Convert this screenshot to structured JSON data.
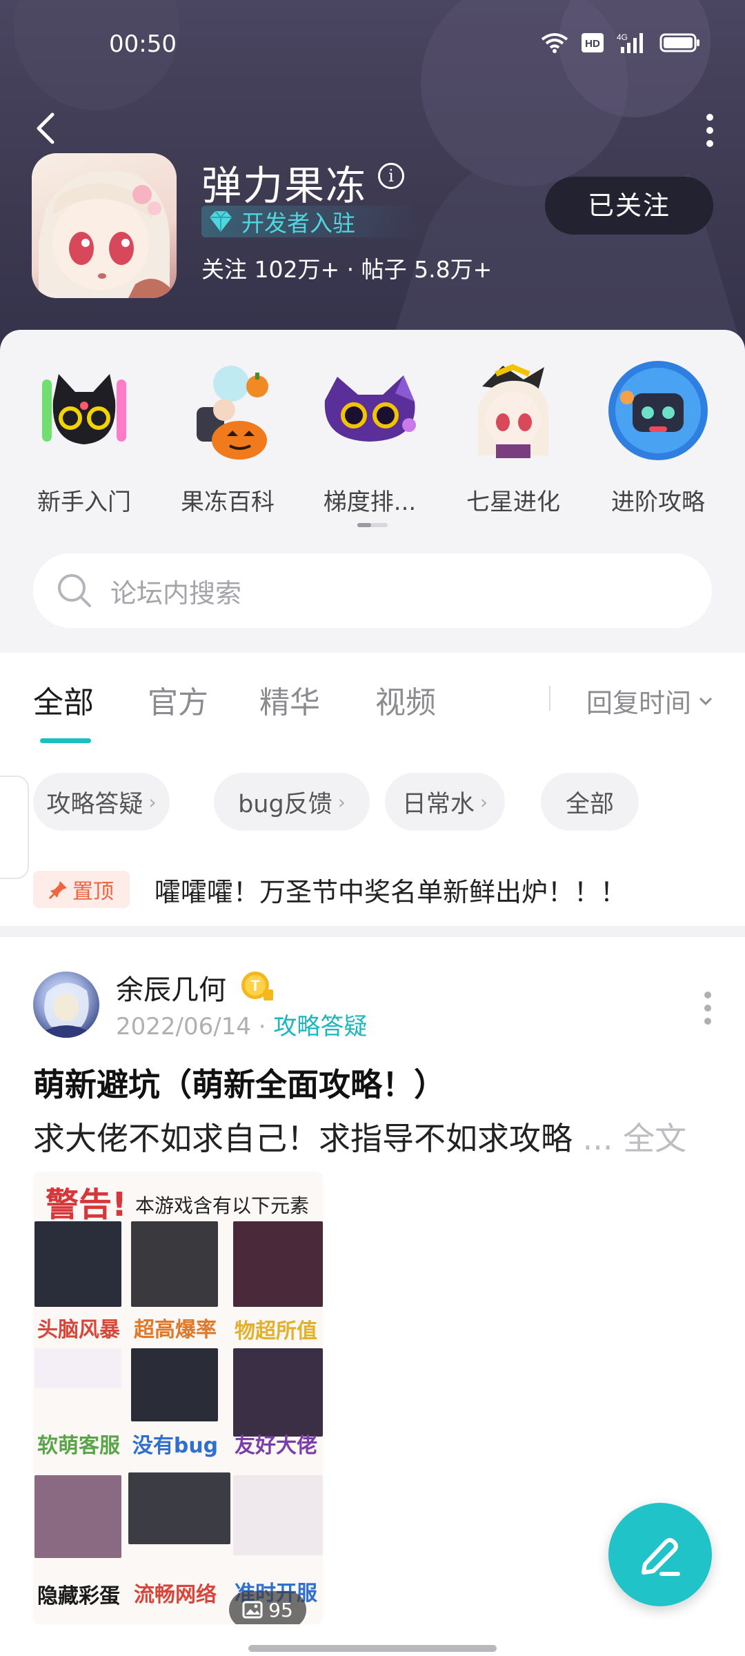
{
  "status_bar": {
    "time": "00:50",
    "icons": [
      "wifi-icon",
      "hd-icon",
      "signal-4g-icon",
      "battery-icon"
    ]
  },
  "header": {
    "app_name": "弹力果冻",
    "badge": "开发者入驻",
    "stats": "关注 102万+ · 帖子 5.8万+",
    "follow_label": "已关注"
  },
  "categories": [
    {
      "label": "新手入门",
      "icon": "black-cat-icon"
    },
    {
      "label": "果冻百科",
      "icon": "pumpkin-character-icon"
    },
    {
      "label": "梯度排...",
      "icon": "purple-cat-icon"
    },
    {
      "label": "七星进化",
      "icon": "chibi-girl-icon"
    },
    {
      "label": "进阶攻略",
      "icon": "robot-icon"
    }
  ],
  "search": {
    "placeholder": "论坛内搜索"
  },
  "tabs": [
    {
      "label": "全部",
      "active": true
    },
    {
      "label": "官方",
      "active": false
    },
    {
      "label": "精华",
      "active": false
    },
    {
      "label": "视频",
      "active": false
    }
  ],
  "sort": {
    "label": "回复时间"
  },
  "chips": [
    {
      "label": "攻略答疑",
      "arrow": "›"
    },
    {
      "label": "bug反馈",
      "arrow": "›"
    },
    {
      "label": "日常水",
      "arrow": "›"
    },
    {
      "label": "全部",
      "arrow": ""
    }
  ],
  "pinned": {
    "badge": "置顶",
    "text": "嚯嚯嚯！万圣节中奖名单新鲜出炉！！！"
  },
  "post": {
    "author": "余辰几何",
    "date": "2022/06/14",
    "dot": "·",
    "tag": "攻略答疑",
    "title": "萌新避坑（萌新全面攻略！）",
    "body": "求大佬不如求自己！求指导不如求攻略",
    "ellipsis": "...",
    "full_label": "全文",
    "image": {
      "warn_title": "警告!",
      "warn_sub": "本游戏含有以下元素",
      "captions": [
        "头脑风暴",
        "超高爆率",
        "物超所值",
        "软萌客服",
        "没有bug",
        "友好大佬",
        "隐藏彩蛋",
        "流畅网络",
        "准时开服"
      ],
      "count": "95"
    }
  },
  "colors": {
    "accent": "#16c0c4",
    "pin": "#f0653f",
    "header_bg": "#3d3a52"
  }
}
